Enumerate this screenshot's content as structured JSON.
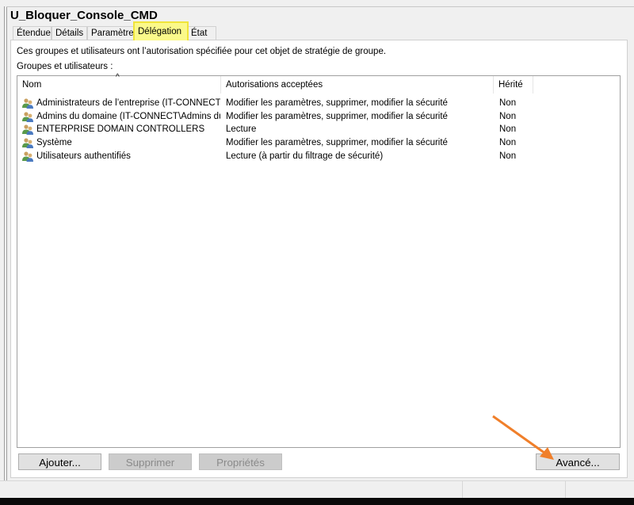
{
  "title": "U_Bloquer_Console_CMD",
  "tabs": [
    {
      "label": "Étendue"
    },
    {
      "label": "Détails"
    },
    {
      "label": "Paramètres"
    },
    {
      "label": "Délégation"
    },
    {
      "label": "État"
    }
  ],
  "description": "Ces groupes et utilisateurs ont l’autorisation spécifiée pour cet objet de stratégie de groupe.",
  "groups_label": "Groupes et utilisateurs :",
  "columns": {
    "name": "Nom",
    "permissions": "Autorisations acceptées",
    "inherited": "Hérité"
  },
  "rows": [
    {
      "name": "Administrateurs de l’entreprise (IT-CONNECT\\A...",
      "permissions": "Modifier les paramètres, supprimer, modifier la sécurité",
      "inherited": "Non"
    },
    {
      "name": "Admins du domaine (IT-CONNECT\\Admins du d...",
      "permissions": "Modifier les paramètres, supprimer, modifier la sécurité",
      "inherited": "Non"
    },
    {
      "name": "ENTERPRISE DOMAIN CONTROLLERS",
      "permissions": "Lecture",
      "inherited": "Non"
    },
    {
      "name": "Système",
      "permissions": "Modifier les paramètres, supprimer, modifier la sécurité",
      "inherited": "Non"
    },
    {
      "name": "Utilisateurs authentifiés",
      "permissions": "Lecture (à partir du filtrage de sécurité)",
      "inherited": "Non"
    }
  ],
  "buttons": {
    "add": "Ajouter...",
    "remove": "Supprimer",
    "properties": "Propriétés",
    "advanced": "Avancé..."
  },
  "colors": {
    "highlight": "#fbf98a",
    "arrow": "#f07f2a"
  }
}
